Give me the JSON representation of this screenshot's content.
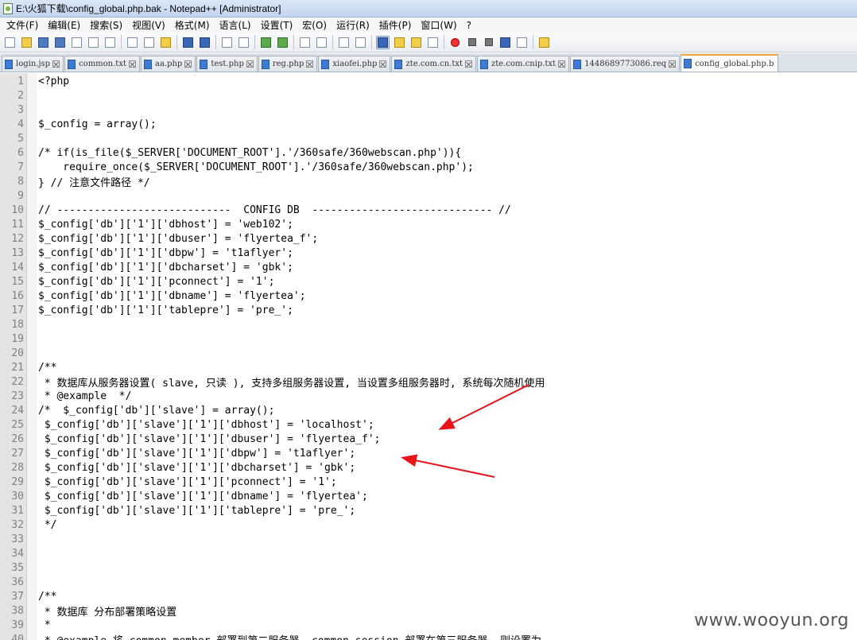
{
  "window": {
    "title": "E:\\火狐下载\\config_global.php.bak - Notepad++ [Administrator]"
  },
  "menu": [
    "文件(F)",
    "编辑(E)",
    "搜索(S)",
    "视图(V)",
    "格式(M)",
    "语言(L)",
    "设置(T)",
    "宏(O)",
    "运行(R)",
    "插件(P)",
    "窗口(W)",
    "?"
  ],
  "toolbar": {
    "buttons": [
      {
        "icon": "new-file-icon"
      },
      {
        "icon": "open-file-icon"
      },
      {
        "icon": "save-icon"
      },
      {
        "icon": "save-all-icon"
      },
      {
        "icon": "close-icon"
      },
      {
        "icon": "close-all-icon"
      },
      {
        "icon": "print-icon"
      },
      {
        "icon": "cut-icon"
      },
      {
        "icon": "copy-icon"
      },
      {
        "icon": "paste-icon"
      },
      {
        "icon": "undo-icon"
      },
      {
        "icon": "redo-icon"
      },
      {
        "icon": "find-icon"
      },
      {
        "icon": "replace-icon"
      },
      {
        "icon": "zoom-in-icon"
      },
      {
        "icon": "zoom-out-icon"
      },
      {
        "icon": "sync-vertical-icon"
      },
      {
        "icon": "sync-horizontal-icon"
      },
      {
        "icon": "word-wrap-icon"
      },
      {
        "icon": "show-all-chars-icon"
      },
      {
        "icon": "indent-guide-icon",
        "active": true
      },
      {
        "icon": "udl-icon"
      },
      {
        "icon": "doc-map-icon"
      },
      {
        "icon": "function-list-icon"
      },
      {
        "icon": "record-macro-icon"
      },
      {
        "icon": "stop-record-icon"
      },
      {
        "icon": "play-macro-icon"
      },
      {
        "icon": "run-macro-multiple-icon"
      },
      {
        "icon": "save-macro-icon"
      },
      {
        "icon": "plugin-icon"
      }
    ]
  },
  "tabs": [
    {
      "label": "login.jsp"
    },
    {
      "label": "common.txt"
    },
    {
      "label": "aa.php"
    },
    {
      "label": "test.php"
    },
    {
      "label": "reg.php"
    },
    {
      "label": "xiaofei.php"
    },
    {
      "label": "zte.com.cn.txt"
    },
    {
      "label": "zte.com.cnip.txt"
    },
    {
      "label": "1448689773086.req"
    },
    {
      "label": "config_global.php.b",
      "active": true
    }
  ],
  "editor": {
    "lines": [
      {
        "n": "1",
        "text": "<?php"
      },
      {
        "n": "2",
        "text": ""
      },
      {
        "n": "3",
        "text": ""
      },
      {
        "n": "4",
        "text": "$_config = array();"
      },
      {
        "n": "5",
        "text": ""
      },
      {
        "n": "6",
        "text": "/* if(is_file($_SERVER['DOCUMENT_ROOT'].'/360safe/360webscan.php')){"
      },
      {
        "n": "7",
        "text": "    require_once($_SERVER['DOCUMENT_ROOT'].'/360safe/360webscan.php');"
      },
      {
        "n": "8",
        "text": "} // 注意文件路径 */"
      },
      {
        "n": "9",
        "text": ""
      },
      {
        "n": "10",
        "text": "// ----------------------------  CONFIG DB  ----------------------------- //"
      },
      {
        "n": "11",
        "text": "$_config['db']['1']['dbhost'] = 'web102';"
      },
      {
        "n": "12",
        "text": "$_config['db']['1']['dbuser'] = 'flyertea_f';"
      },
      {
        "n": "13",
        "text": "$_config['db']['1']['dbpw'] = 't1aflyer';"
      },
      {
        "n": "14",
        "text": "$_config['db']['1']['dbcharset'] = 'gbk';"
      },
      {
        "n": "15",
        "text": "$_config['db']['1']['pconnect'] = '1';"
      },
      {
        "n": "16",
        "text": "$_config['db']['1']['dbname'] = 'flyertea';"
      },
      {
        "n": "17",
        "text": "$_config['db']['1']['tablepre'] = 'pre_';"
      },
      {
        "n": "18",
        "text": ""
      },
      {
        "n": "19",
        "text": ""
      },
      {
        "n": "20",
        "text": ""
      },
      {
        "n": "21",
        "text": "/**"
      },
      {
        "n": "22",
        "text": " * 数据库从服务器设置( slave, 只读 ), 支持多组服务器设置, 当设置多组服务器时, 系统每次随机使用"
      },
      {
        "n": "23",
        "text": " * @example  */"
      },
      {
        "n": "24",
        "text": "/*  $_config['db']['slave'] = array();"
      },
      {
        "n": "25",
        "text": " $_config['db']['slave']['1']['dbhost'] = 'localhost';"
      },
      {
        "n": "26",
        "text": " $_config['db']['slave']['1']['dbuser'] = 'flyertea_f';"
      },
      {
        "n": "27",
        "text": " $_config['db']['slave']['1']['dbpw'] = 't1aflyer';"
      },
      {
        "n": "28",
        "text": " $_config['db']['slave']['1']['dbcharset'] = 'gbk';"
      },
      {
        "n": "29",
        "text": " $_config['db']['slave']['1']['pconnect'] = '1';"
      },
      {
        "n": "30",
        "text": " $_config['db']['slave']['1']['dbname'] = 'flyertea';"
      },
      {
        "n": "31",
        "text": " $_config['db']['slave']['1']['tablepre'] = 'pre_';"
      },
      {
        "n": "32",
        "text": " */"
      },
      {
        "n": "33",
        "text": ""
      },
      {
        "n": "34",
        "text": ""
      },
      {
        "n": "35",
        "text": ""
      },
      {
        "n": "36",
        "text": ""
      },
      {
        "n": "37",
        "text": "/**"
      },
      {
        "n": "38",
        "text": " * 数据库 分布部署策略设置"
      },
      {
        "n": "39",
        "text": " *"
      },
      {
        "n": "40",
        "text": " * @example 将 common_member 部署到第二服务器, common_session 部署在第三服务器, 则设置为"
      }
    ]
  },
  "annotation": {
    "arrow_color": "#e8141a"
  },
  "watermark": {
    "text": "www.wooyun.org"
  }
}
